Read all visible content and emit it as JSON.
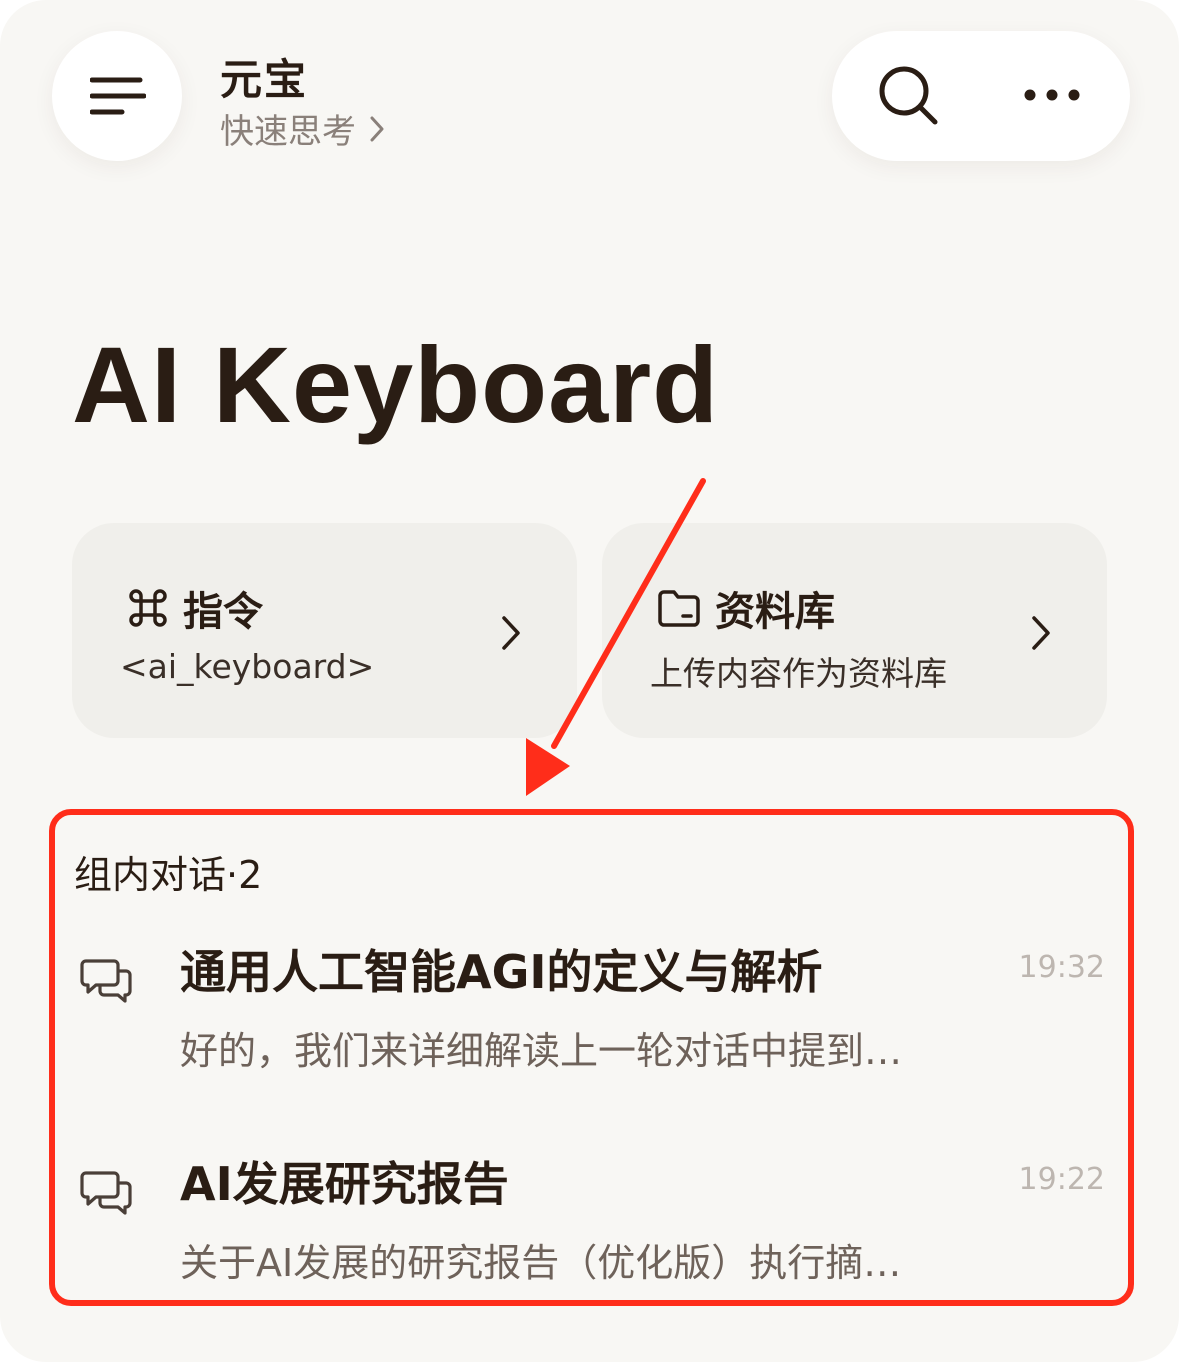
{
  "header": {
    "title": "元宝",
    "subtitle": "快速思考"
  },
  "icons": {
    "menu": "menu-icon",
    "chevron": "chevron-right-icon",
    "search": "search-icon",
    "more": "more-horizontal-icon",
    "command": "command-icon",
    "folder": "folder-icon",
    "chat": "chat-bubbles-icon"
  },
  "colors": {
    "background": "#f8f7f4",
    "card": "#f0efeb",
    "text": "#2a1d14",
    "muted": "#6e625a",
    "annotation": "#ff2d1a"
  },
  "page": {
    "title": "AI Keyboard"
  },
  "cards": [
    {
      "title": "指令",
      "subtitle": "<ai_keyboard>"
    },
    {
      "title": "资料库",
      "subtitle": "上传内容作为资料库"
    }
  ],
  "conversations": {
    "label": "组内对话·2",
    "items": [
      {
        "title": "通用人工智能AGI的定义与解析",
        "preview": "好的，我们来详细解读上一轮对话中提到…",
        "time": "19:32"
      },
      {
        "title": "AI发展研究报告",
        "preview": "关于AI发展的研究报告（优化版）执行摘…",
        "time": "19:22"
      }
    ]
  }
}
